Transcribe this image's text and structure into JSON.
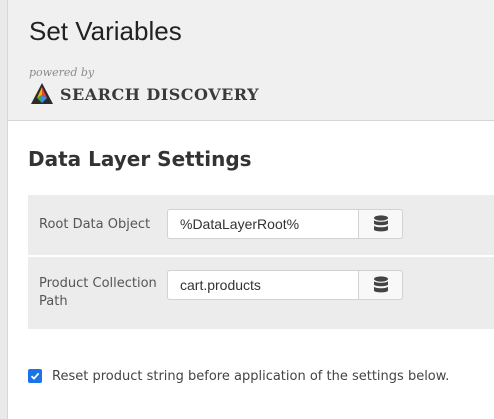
{
  "header": {
    "title": "Set Variables",
    "powered_by": "powered by",
    "brand_name": "SEARCH DISCOVERY"
  },
  "section": {
    "title": "Data Layer Settings"
  },
  "settings": {
    "rows": [
      {
        "label": "Root Data Object",
        "value": "%DataLayerRoot%",
        "icon": "database-icon"
      },
      {
        "label": "Product Collection Path",
        "value": "cart.products",
        "icon": "database-icon"
      }
    ]
  },
  "reset_option": {
    "checked": true,
    "label": "Reset product string before application of the settings below."
  },
  "colors": {
    "header_bg": "#f0f0f0",
    "panel_bg": "#ececec",
    "checkbox_accent": "#1a73e8"
  }
}
